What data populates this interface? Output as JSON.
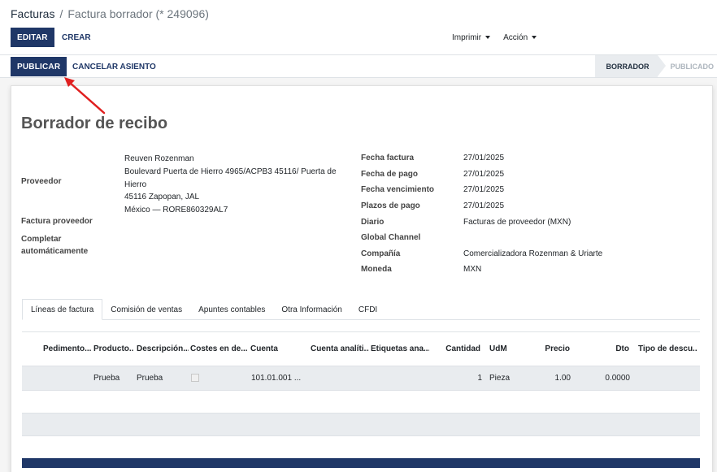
{
  "breadcrumb": {
    "parent": "Facturas",
    "separator": "/",
    "current": "Factura borrador (* 249096)"
  },
  "toolbar": {
    "edit_label": "EDITAR",
    "create_label": "CREAR",
    "print_label": "Imprimir",
    "action_label": "Acción"
  },
  "statusbar": {
    "publish_label": "PUBLICAR",
    "cancel_label": "CANCELAR ASIENTO",
    "stages": [
      "BORRADOR",
      "PUBLICADO"
    ],
    "active_stage": "BORRADOR"
  },
  "form": {
    "title": "Borrador de recibo",
    "left": {
      "vendor_label": "Proveedor",
      "vendor_address": [
        "Reuven Rozenman",
        "Boulevard Puerta de Hierro 4965/ACPB3 45116/ Puerta de Hierro",
        "45116 Zapopan, JAL",
        "México — RORE860329AL7"
      ],
      "vendor_invoice_label": "Factura proveedor",
      "autocomplete_label": "Completar automáticamente"
    },
    "right": [
      {
        "label": "Fecha factura",
        "value": "27/01/2025"
      },
      {
        "label": "Fecha de pago",
        "value": "27/01/2025"
      },
      {
        "label": "Fecha vencimiento",
        "value": "27/01/2025"
      },
      {
        "label": "Plazos de pago",
        "value": "27/01/2025"
      },
      {
        "label": "Diario",
        "value": "Facturas de proveedor (MXN)"
      },
      {
        "label": "Global Channel",
        "value": ""
      },
      {
        "label": "Compañía",
        "value": "Comercializadora Rozenman & Uriarte"
      },
      {
        "label": "Moneda",
        "value": "MXN"
      }
    ]
  },
  "tabs": [
    "Líneas de factura",
    "Comisión de ventas",
    "Apuntes contables",
    "Otra Información",
    "CFDI"
  ],
  "table": {
    "headers": [
      "Pedimento...",
      "Producto...",
      "Descripción...",
      "Costes en de...",
      "Cuenta",
      "Cuenta analíti...",
      "Etiquetas ana...",
      "Cantidad",
      "UdM",
      "Precio",
      "Dto",
      "Tipo de descu..."
    ],
    "rows": [
      {
        "producto": "Prueba",
        "descripcion": "Prueba",
        "cuenta": "101.01.001 ...",
        "cantidad": "1",
        "udm": "Pieza",
        "precio": "1.00",
        "dto": "0.0000"
      }
    ]
  },
  "colors": {
    "primary": "#1f3767",
    "annotation_arrow": "#e02020"
  }
}
